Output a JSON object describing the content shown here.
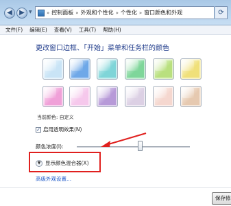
{
  "address_bar": {
    "separator": "»",
    "crumbs": [
      "控制面板",
      "外观和个性化",
      "个性化",
      "窗口颜色和外观"
    ]
  },
  "menu": {
    "items": [
      "文件(F)",
      "编辑(E)",
      "查看(V)",
      "工具(T)",
      "帮助(H)"
    ]
  },
  "page": {
    "heading": "更改窗口边框、「开始」菜单和任务栏的颜色",
    "current_color_label": "当前颜色: 自定义",
    "transparency_label": "启用透明效果(N)",
    "transparency_checked": true,
    "intensity_label": "颜色浓度(I):",
    "intensity_value": 0.55,
    "mixer_label": "显示颜色混合器(X)",
    "advanced_link": "高级外观设置...",
    "save_button": "保存修改"
  },
  "swatches": {
    "row1": [
      "#c9e4f6",
      "#6ea8e8",
      "#7fd5d8",
      "#7fd69a",
      "#b9e07e",
      "#f0e07a"
    ],
    "row2": [
      "#f0a0d8",
      "#f6c8ec",
      "#b79ad8",
      "#dcd0e4",
      "#f5d7cf",
      "#e6c9b0"
    ]
  },
  "colors": {
    "link": "#1a56c9",
    "heading": "#1e3a8a",
    "highlight": "#e0201e"
  }
}
